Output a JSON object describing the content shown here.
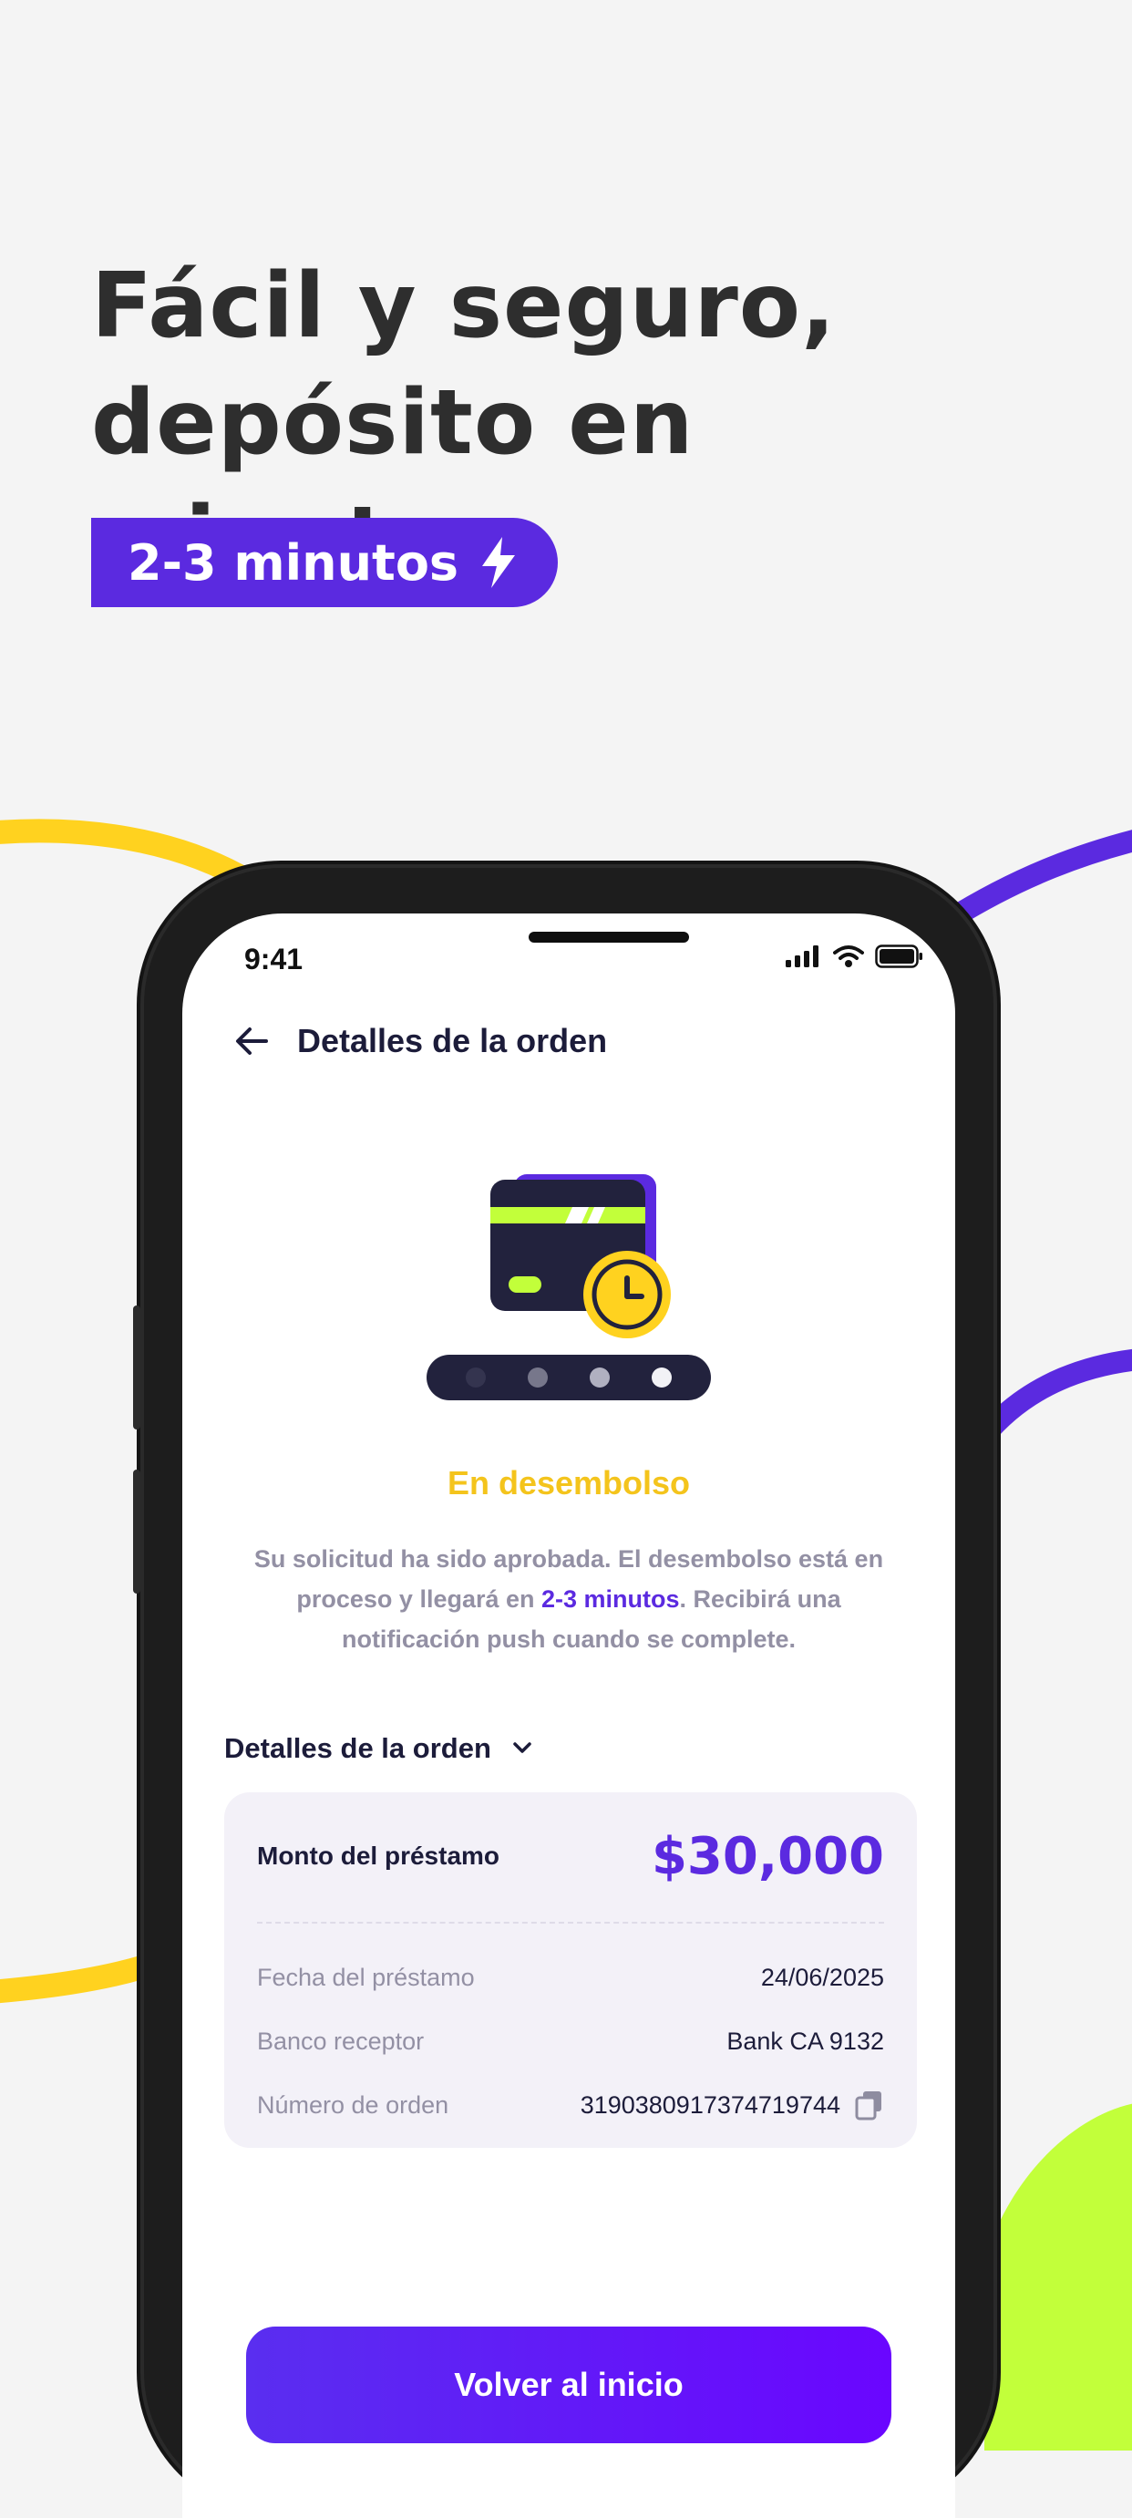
{
  "promo": {
    "headline_line1": "Fácil y seguro,",
    "headline_line2": "depósito en minutos",
    "badge_text": "2-3 minutos",
    "badge_icon": "lightning-bolt-icon"
  },
  "colors": {
    "brand_purple": "#5b2ae0",
    "accent_yellow": "#ffd21f",
    "accent_lime": "#c2ff3a",
    "background": "#f4f4f4"
  },
  "status_bar": {
    "time": "9:41",
    "icons": [
      "cellular-signal-icon",
      "wifi-icon",
      "battery-icon"
    ]
  },
  "nav": {
    "title": "Detalles de la orden",
    "back_icon": "arrow-left-icon"
  },
  "order_status": {
    "title": "En desembolso",
    "desc_part1": "Su solicitud ha sido aprobada. El desembolso está en proceso y llegará en ",
    "desc_highlight": "2-3 minutos",
    "desc_part2": ". Recibirá una notificación push cuando se complete.",
    "progress_steps_total": 4,
    "illustration_icons": [
      "credit-card-icon",
      "clock-icon"
    ]
  },
  "details": {
    "section_title": "Detalles de la orden",
    "amount_label": "Monto del préstamo",
    "amount_value": "$30,000",
    "rows": [
      {
        "label": "Fecha del préstamo",
        "value": "24/06/2025"
      },
      {
        "label": "Banco receptor",
        "value": "Bank CA 9132"
      },
      {
        "label": "Número de orden",
        "value": "3190380917374719744"
      }
    ]
  },
  "actions": {
    "primary_button": "Volver al inicio"
  }
}
